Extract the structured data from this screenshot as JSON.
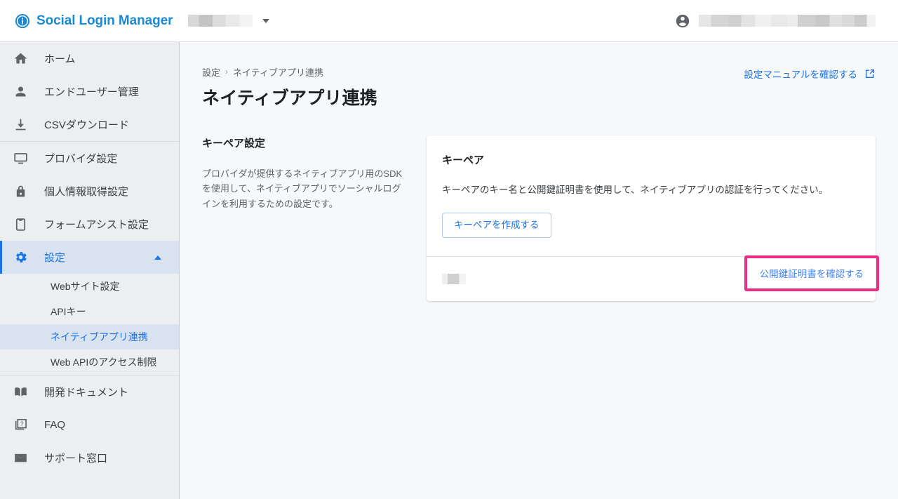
{
  "header": {
    "brand_icon": "info-badge-icon",
    "brand_title": "Social Login Manager",
    "tenant_selector_icon": "chevron-down-icon",
    "tenant_value_masked": "",
    "account_icon": "account-circle-icon",
    "account_value_masked": ""
  },
  "sidebar": {
    "groups": [
      {
        "items": [
          {
            "label": "ホーム",
            "icon": "home-icon",
            "name": "home",
            "active": false
          },
          {
            "label": "エンドユーザー管理",
            "icon": "person-icon",
            "name": "end-user-management",
            "active": false
          },
          {
            "label": "CSVダウンロード",
            "icon": "download-icon",
            "name": "csv-download",
            "active": false
          }
        ]
      },
      {
        "items": [
          {
            "label": "プロバイダ設定",
            "icon": "monitor-icon",
            "name": "provider-settings",
            "active": false
          },
          {
            "label": "個人情報取得設定",
            "icon": "lock-icon",
            "name": "personal-info-settings",
            "active": false
          },
          {
            "label": "フォームアシスト設定",
            "icon": "clipboard-icon",
            "name": "form-assist-settings",
            "active": false
          },
          {
            "label": "設定",
            "icon": "gear-icon",
            "name": "settings",
            "active": true,
            "expanded": true,
            "expand_icon": "chevron-up-icon"
          }
        ],
        "subitems": [
          {
            "label": "Webサイト設定",
            "name": "website-settings",
            "active": false
          },
          {
            "label": "APIキー",
            "name": "api-key",
            "active": false
          },
          {
            "label": "ネイティブアプリ連携",
            "name": "native-app-integration",
            "active": true
          },
          {
            "label": "Web APIのアクセス制限",
            "name": "web-api-access-restriction",
            "active": false
          }
        ]
      },
      {
        "items": [
          {
            "label": "開発ドキュメント",
            "icon": "book-icon",
            "name": "developer-docs",
            "active": false
          },
          {
            "label": "FAQ",
            "icon": "faq-page-icon",
            "name": "faq",
            "active": false
          },
          {
            "label": "サポート窓口",
            "icon": "mail-icon",
            "name": "support-contact",
            "active": false
          }
        ]
      }
    ]
  },
  "main": {
    "breadcrumb": {
      "parent": "設定",
      "separator": "›",
      "current": "ネイティブアプリ連携"
    },
    "page_title": "ネイティブアプリ連携",
    "manual_link": {
      "label": "設定マニュアルを確認する",
      "icon": "external-link-icon"
    },
    "left_section": {
      "title": "キーペア設定",
      "description": "プロバイダが提供するネイティブアプリ用のSDKを使用して、ネイティブアプリでソーシャルログインを利用するための設定です。"
    },
    "card": {
      "title": "キーペア",
      "description": "キーペアのキー名と公開鍵証明書を使用して、ネイティブアプリの認証を行ってください。",
      "create_button_label": "キーペアを作成する",
      "row": {
        "key_name_masked": "",
        "view_cert_button_label": "公開鍵証明書を確認する",
        "highlight_color": "#ec2f86"
      }
    }
  },
  "colors": {
    "brand_blue": "#1a8ad6",
    "link_blue": "#1a73e8",
    "active_nav_bg": "#d9e2ef",
    "sidebar_bg": "#eceef0",
    "main_bg": "#f6f8f9",
    "highlight_pink": "#ec2f86"
  }
}
